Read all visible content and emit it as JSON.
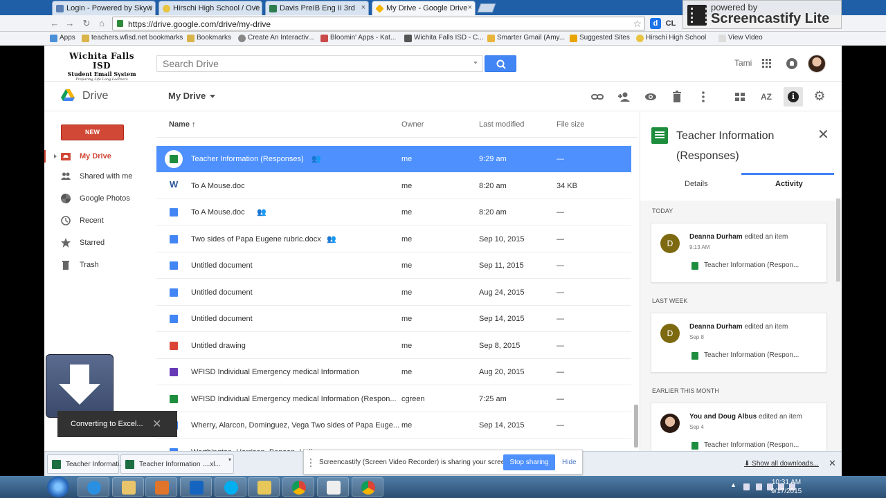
{
  "browser": {
    "tabs": [
      {
        "title": "Login - Powered by Skyw",
        "favicon_color": "#5a7fb5"
      },
      {
        "title": "Hirschi High School / Ove",
        "favicon_color": "#e8c440"
      },
      {
        "title": "Davis PreIB Eng II 3rd",
        "favicon_color": "#2e7d4f"
      },
      {
        "title": "My Drive - Google Drive",
        "favicon_color": "#f4b400"
      }
    ],
    "url": "https://drive.google.com/drive/my-drive",
    "bookmarks": [
      "Apps",
      "teachers.wfisd.net bookmarks",
      "Bookmarks",
      "Create An Interactiv...",
      "Bloomin' Apps - Kat...",
      "Wichita Falls ISD - C...",
      "Smarter Gmail (Amy...",
      "Suggested Sites",
      "Hirschi High School",
      "View Video"
    ],
    "ext_labels": [
      "d",
      "CL"
    ],
    "overlay": {
      "line1": "powered by",
      "line2": "Screencastify Lite",
      "user": "Tami"
    }
  },
  "header": {
    "logo_line1": "Wichita Falls ISD",
    "logo_line2": "Student Email System",
    "logo_line3": "Preparing Life Long Learners",
    "search_placeholder": "Search Drive",
    "user_name": "Tami"
  },
  "subheader": {
    "app_name": "Drive",
    "location": "My Drive",
    "icons": [
      "link-icon",
      "add-person-icon",
      "preview-eye-icon",
      "trash-icon",
      "more-vert-icon",
      "grid-view-icon",
      "sort-az-icon",
      "info-icon",
      "settings-gear-icon"
    ]
  },
  "sidebar": {
    "new_label": "NEW",
    "items": [
      {
        "label": "My Drive",
        "icon": "my-drive-icon"
      },
      {
        "label": "Shared with me",
        "icon": "people-icon"
      },
      {
        "label": "Google Photos",
        "icon": "photos-pinwheel-icon"
      },
      {
        "label": "Recent",
        "icon": "clock-icon"
      },
      {
        "label": "Starred",
        "icon": "star-icon"
      },
      {
        "label": "Trash",
        "icon": "trash-icon"
      }
    ]
  },
  "list": {
    "columns": {
      "name": "Name",
      "sort_arrow": "↑",
      "owner": "Owner",
      "modified": "Last modified",
      "size": "File size"
    },
    "rows": [
      {
        "name": "Teacher Information (Responses)",
        "type": "sheet",
        "shared": true,
        "owner": "me",
        "modified": "9:29 am",
        "size": "—",
        "selected": true
      },
      {
        "name": "To A Mouse.doc",
        "type": "word",
        "shared": false,
        "owner": "me",
        "modified": "8:20 am",
        "size": "34 KB"
      },
      {
        "name": "To A Mouse.doc",
        "type": "doc",
        "shared": true,
        "owner": "me",
        "modified": "8:20 am",
        "size": "—"
      },
      {
        "name": "Two sides of Papa Eugene rubric.docx",
        "type": "doc",
        "shared": true,
        "owner": "me",
        "modified": "Sep 10, 2015",
        "size": "—"
      },
      {
        "name": "Untitled document",
        "type": "doc",
        "shared": false,
        "owner": "me",
        "modified": "Sep 11, 2015",
        "size": "—"
      },
      {
        "name": "Untitled document",
        "type": "doc",
        "shared": false,
        "owner": "me",
        "modified": "Aug 24, 2015",
        "size": "—"
      },
      {
        "name": "Untitled document",
        "type": "doc",
        "shared": false,
        "owner": "me",
        "modified": "Sep 14, 2015",
        "size": "—"
      },
      {
        "name": "Untitled drawing",
        "type": "drawing",
        "shared": false,
        "owner": "me",
        "modified": "Sep 8, 2015",
        "size": "—"
      },
      {
        "name": "WFISD Individual Emergency medical Information",
        "type": "form",
        "shared": false,
        "owner": "me",
        "modified": "Aug 20, 2015",
        "size": "—"
      },
      {
        "name": "WFISD Individual Emergency medical Information (Respon...",
        "type": "sheet",
        "shared": false,
        "owner": "cgreen",
        "modified": "7:25 am",
        "size": "—"
      },
      {
        "name": "Wherry, Alarcon, Dominguez, Vega Two sides of Papa Euge...",
        "type": "doc",
        "shared": false,
        "owner": "me",
        "modified": "Sep 14, 2015",
        "size": "—"
      },
      {
        "name": "Worthington, Harrison, Benson, Hall...",
        "type": "doc",
        "shared": false,
        "owner": "me",
        "modified": "",
        "size": ""
      }
    ]
  },
  "details": {
    "title": "Teacher Information (Responses)",
    "tabs": [
      "Details",
      "Activity"
    ],
    "active_tab": "Activity",
    "sections": [
      {
        "label": "TODAY",
        "actor": "Deanna Durham",
        "action": "edited an item",
        "time": "9:13 AM",
        "file": "Teacher Information (Respon...",
        "avatar": "D"
      },
      {
        "label": "LAST WEEK",
        "actor": "Deanna Durham",
        "action": "edited an item",
        "time": "Sep 8",
        "file": "Teacher Information (Respon...",
        "avatar": "D"
      },
      {
        "label": "EARLIER THIS MONTH",
        "actor": "You and Doug Albus",
        "action": "edited an item",
        "time": "Sep 4",
        "file": "Teacher Information (Respon...",
        "avatar": ""
      }
    ]
  },
  "toast": {
    "message": "Converting to Excel..."
  },
  "downloads": {
    "items": [
      "Teacher Informati...",
      "Teacher Information ....xl..."
    ],
    "show_all": "Show all downloads..."
  },
  "share_notice": {
    "message": "Screencastify (Screen Video Recorder) is sharing your screen.",
    "stop_label": "Stop sharing",
    "hide_label": "Hide"
  },
  "taskbar": {
    "time": "10:31 AM",
    "date": "9/17/2015"
  },
  "colors": {
    "accent_blue": "#4d90fe",
    "new_red": "#d14836",
    "sheet_green": "#1e8e3e",
    "doc_blue": "#4285f4"
  }
}
